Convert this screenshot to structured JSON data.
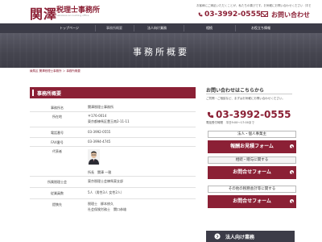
{
  "header": {
    "logo_kanji": "関澤",
    "logo_sub": "税理士事務所",
    "logo_en": "sekizawa accounting office",
    "note": "お客様にご満足いただくことが、私たちの喜びです。お気軽にお問い合わせください（平日9:00～17:00）",
    "phone": "03-3992-0555",
    "contact": "お問い合わせ"
  },
  "nav": {
    "items": [
      {
        "label": "トップページ"
      },
      {
        "label": "事務所概要"
      },
      {
        "label": "法人向け業務"
      },
      {
        "label": "相続"
      },
      {
        "label": "お役立ち情報"
      }
    ]
  },
  "banner": {
    "title": "事務所概要"
  },
  "breadcrumb": {
    "text": "練馬区 関澤税理士事務所 ＞ 事務所概要"
  },
  "main": {
    "section_title": "事務所概要",
    "rows": [
      {
        "label": "事務所名",
        "value": "関澤税理士事務所"
      },
      {
        "label": "所在地",
        "value1": "〒176-0014",
        "value2": "東京都練馬区豊玉南2-11-11"
      },
      {
        "label": "電話番号",
        "value": "03-3992-0555"
      },
      {
        "label": "FAX番号",
        "value": "03-3994-4745"
      },
      {
        "label": "代表者",
        "name": "所長　関澤 一雅"
      },
      {
        "label": "所属税理士会",
        "value": "東京税理士会練馬東支部"
      },
      {
        "label": "従業員数",
        "value": "5人（男性3人 女性2人）"
      },
      {
        "label": "提携先",
        "value1": "税理士　柳本修久",
        "value2": "社会保険労務士　関口恭雄"
      }
    ]
  },
  "sidebar": {
    "title": "お問い合わせはこちらから",
    "desc": "ご質問・ご相談など、まずはお気軽にお問い合わせください。",
    "phone": "03-3992-0555",
    "hours": "電話受付時間　平日9:00～17:00まで",
    "categories": [
      {
        "label": "法人・個人事業主",
        "cta": "報酬お見積フォーム"
      },
      {
        "label": "相続・贈与に関する",
        "cta": "お問合せフォーム"
      },
      {
        "label": "その他の税務会計等に関する",
        "cta": "お問合せフォーム"
      }
    ],
    "banner": "法人向け業務"
  },
  "colors": {
    "accent": "#8b2035",
    "nav": "#3c3c48"
  }
}
